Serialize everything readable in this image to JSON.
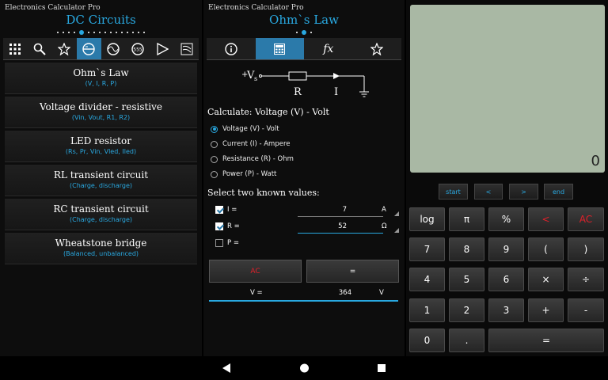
{
  "app_name": "Electronics Calculator Pro",
  "left": {
    "title": "DC Circuits",
    "items": [
      {
        "title": "Ohm`s Law",
        "sub": "(V, I, R, P)"
      },
      {
        "title": "Voltage divider - resistive",
        "sub": "(Vin, Vout, R1, R2)"
      },
      {
        "title": "LED resistor",
        "sub": "(Rs, Pr, Vin, Vled, Iled)"
      },
      {
        "title": "RL transient circuit",
        "sub": "(Charge, discharge)"
      },
      {
        "title": "RC transient circuit",
        "sub": "(Charge, discharge)"
      },
      {
        "title": "Wheatstone bridge",
        "sub": "(Balanced, unbalanced)"
      }
    ]
  },
  "middle": {
    "title": "Ohm`s Law",
    "fx_label": "fx",
    "circuit": {
      "vs_plus": "+",
      "vs": "V",
      "vs_sub": "s",
      "r": "R",
      "i": "I"
    },
    "calculate_label": "Calculate: Voltage (V) - Volt",
    "options": [
      "Voltage (V) - Volt",
      "Current (I) - Ampere",
      "Resistance (R) - Ohm",
      "Power (P) - Watt"
    ],
    "known_label": "Select two known values:",
    "inputs": [
      {
        "label": "I =",
        "value": "7",
        "unit": "A"
      },
      {
        "label": "R =",
        "value": "52",
        "unit": "Ω"
      },
      {
        "label": "P =",
        "value": "",
        "unit": ""
      }
    ],
    "ac_label": "AC",
    "eq_label": "=",
    "result": {
      "label": "V =",
      "value": "364",
      "unit": "V"
    }
  },
  "right": {
    "display": "0",
    "nav": [
      "start",
      "<",
      ">",
      "end"
    ],
    "keys": {
      "r1": [
        "log",
        "π",
        "%",
        "<",
        "AC"
      ],
      "r2": [
        "7",
        "8",
        "9",
        "(",
        ")"
      ],
      "r3": [
        "4",
        "5",
        "6",
        "×",
        "÷"
      ],
      "r4": [
        "1",
        "2",
        "3",
        "+",
        "-"
      ],
      "r5": [
        "0",
        ".",
        "="
      ]
    }
  },
  "colors": {
    "accent": "#29a8e0",
    "red": "#e0202a",
    "lcd": "#a9b8a4"
  },
  "toolbar_icons_left": [
    "grid-icon",
    "search-icon",
    "star-icon",
    "dc-circuits-icon",
    "ac-circuits-icon",
    "ic-555-icon",
    "amplifier-icon",
    "filter-icon"
  ],
  "toolbar_icons_middle": [
    "info-icon",
    "calculator-icon",
    "formula-icon",
    "star-icon"
  ]
}
